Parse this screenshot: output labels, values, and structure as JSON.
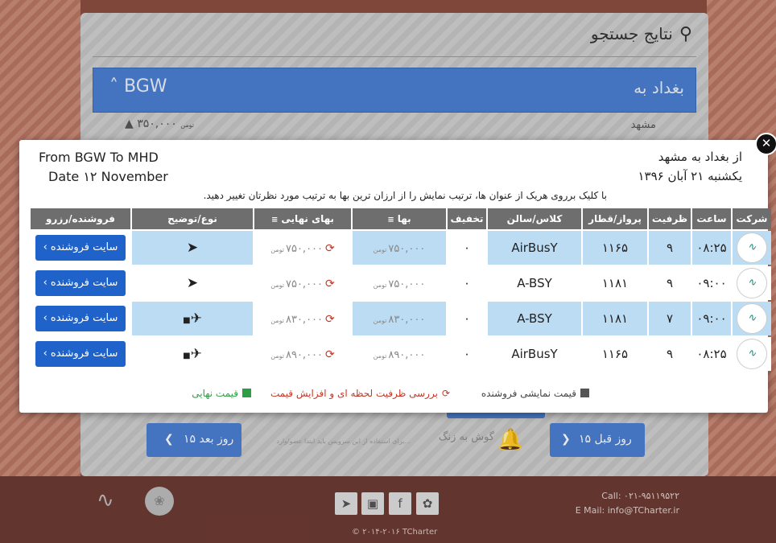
{
  "page": {
    "search_title": "نتایج جستجو",
    "route_fa": "بغداد به",
    "route_code": "BGW",
    "route_chevron": "˄",
    "sub_city": "مشهد",
    "sub_price": "۳۵۰,۰۰۰",
    "sub_unit": "تومن",
    "prev_label": "۱۵ روز قبل",
    "next_label": "۱۵ روز بعد",
    "bell_title": "گوش به زنگ",
    "bell_desc": "برای استفاده از این سرویس باید ابتدا عضو/وارد...",
    "footer": {
      "call": "Call: ۰۲۱-۹۵۱۱۹۵۲۲",
      "mail": "E Mail: info@TCharter.ir",
      "copy": "© ۲۰۱۴-۲۰۱۶ TCharter"
    }
  },
  "modal": {
    "en_route": "From BGW To MHD",
    "en_date": "Date ۱۲ November",
    "fa_route": "از بغداد به مشهد",
    "fa_date": "یکشنبه ۲۱ آبان ۱۳۹۶",
    "hint": "با کلیک برروی هریک از عنوان ها، ترتیب نمایش را از ارزان ترین بها به ترتیب مورد نظرتان تغییر دهید.",
    "columns": [
      "شرکت",
      "ساعت",
      "ظرفیت",
      "پرواز/قطار",
      "کلاس/سالن",
      "تخفیف",
      "بها",
      "بهای نهایی",
      "نوع/توضیح",
      "فروشنده/رزرو"
    ],
    "rows": [
      {
        "time": "۰۸:۲۵",
        "capacity": "۹",
        "flight": "۱۱۶۵",
        "class": "AirBusY",
        "discount": "۰",
        "price": "۷۵۰,۰۰۰",
        "final": "۷۵۰,۰۰۰",
        "unit": "تومن",
        "seller": "سایت فروشنده ›",
        "type_icon": "paper-plane-icon"
      },
      {
        "time": "۰۹:۰۰",
        "capacity": "۹",
        "flight": "۱۱۸۱",
        "class": "A-BSY",
        "discount": "۰",
        "price": "۷۵۰,۰۰۰",
        "final": "۷۵۰,۰۰۰",
        "unit": "تومن",
        "seller": "سایت فروشنده ›",
        "type_icon": "paper-plane-icon"
      },
      {
        "time": "۰۹:۰۰",
        "capacity": "۷",
        "flight": "۱۱۸۱",
        "class": "A-BSY",
        "discount": "۰",
        "price": "۸۳۰,۰۰۰",
        "final": "۸۳۰,۰۰۰",
        "unit": "تومن",
        "seller": "سایت فروشنده ›",
        "type_icon": "plane-luggage-icon"
      },
      {
        "time": "۰۸:۲۵",
        "capacity": "۹",
        "flight": "۱۱۶۵",
        "class": "AirBusY",
        "discount": "۰",
        "price": "۸۹۰,۰۰۰",
        "final": "۸۹۰,۰۰۰",
        "unit": "تومن",
        "seller": "سایت فروشنده ›",
        "type_icon": "plane-luggage-icon"
      }
    ],
    "legend": {
      "seller_price": "قیمت نمایشی فروشنده",
      "capacity_check": "بررسی ظرفیت لحظه ای و افزایش قیمت",
      "final_price": "قیمت نهایی"
    },
    "colors": {
      "alt_row": "#bcdcf4",
      "header": "#6e6e6e",
      "button": "#1f62c9",
      "legend_gray": "#555555",
      "legend_green": "#2e9e45",
      "accent_red": "#c0392b"
    }
  }
}
